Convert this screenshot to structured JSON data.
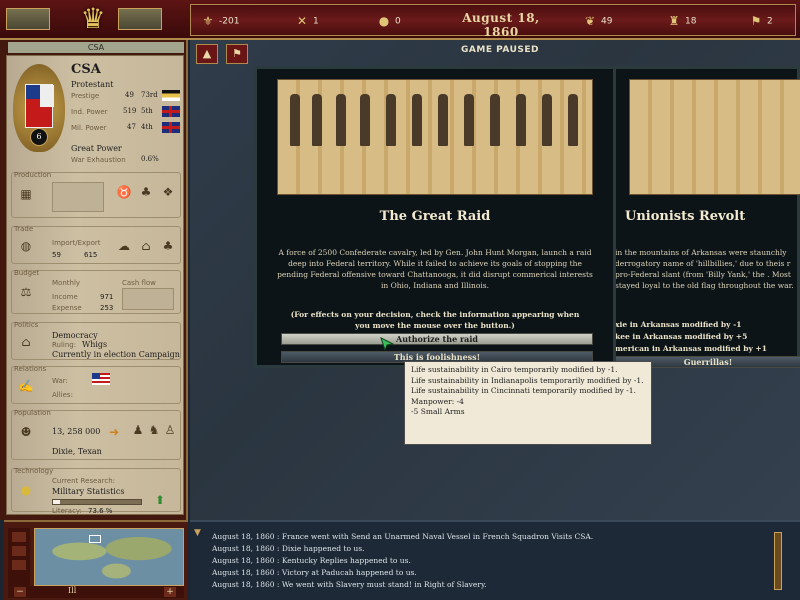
{
  "topbar": {
    "date": "August 18, 1860",
    "resources": [
      {
        "icon": "money-icon",
        "value": "-201"
      },
      {
        "icon": "crossed-swords-icon",
        "value": "1"
      },
      {
        "icon": "lightbulb-icon",
        "value": "0"
      },
      {
        "icon": "laurel-icon",
        "value": "49"
      },
      {
        "icon": "soldier-icon",
        "value": "18"
      },
      {
        "icon": "flag-icon",
        "value": "2"
      }
    ]
  },
  "nation": {
    "tab": "CSA",
    "name": "CSA",
    "religion": "Protestant",
    "prestige_label": "Prestige",
    "prestige_value": "49",
    "prestige_rank": "73rd",
    "ind_label": "Ind. Power",
    "ind_value": "519",
    "ind_rank": "5th",
    "mil_label": "Mil. Power",
    "mil_value": "47",
    "mil_rank": "4th",
    "rank_badge": "6",
    "status": "Great Power",
    "war_exh_label": "War Exhaustion",
    "war_exh_value": "0.6%"
  },
  "production": {
    "title": "Production"
  },
  "trade": {
    "title": "Trade",
    "label": "Import/Export",
    "import": "59",
    "export": "615"
  },
  "budget": {
    "title": "Budget",
    "monthly": "Monthly",
    "cashflow": "Cash flow",
    "income_label": "Income",
    "income": "971",
    "expense_label": "Expense",
    "expense": "253"
  },
  "politics": {
    "title": "Politics",
    "government": "Democracy",
    "ruling_label": "Ruling:",
    "ruling": "Whigs",
    "election": "Currently in election Campaign"
  },
  "relations": {
    "title": "Relations",
    "war_label": "War:",
    "allies_label": "Allies:"
  },
  "population": {
    "title": "Population",
    "count": "13, 258 000",
    "culture": "Dixie, Texan"
  },
  "technology": {
    "title": "Technology",
    "current_label": "Current Research:",
    "current": "Military Statistics",
    "literacy_label": "Literacy:",
    "literacy": "73.6 %",
    "progress": 0.08
  },
  "map": {
    "paused": "GAME PAUSED"
  },
  "event_main": {
    "title": "The Great Raid",
    "text": "A force of 2500 Confederate cavalry, led by Gen. John Hunt Morgan, launch a raid deep into Federal territory. While it failed to achieve its goals of stopping the pending Federal offensive toward Chattanooga, it did disrupt commerical interests in Ohio, Indiana and Illinois.",
    "note": "(For effects on your decision, check the information appearing when you move the mouse over the button.)",
    "option_a": "Authorize the raid",
    "option_b": "This is foolishness!"
  },
  "event_back": {
    "title": "Unionists Revolt",
    "text": "in the mountains of Arkansas were staunchly derrogatory name of 'hillbillies,' due to theis r pro-Federal slant (from 'Billy Yank,' the . Most stayed loyal to the old flag throughout the war.",
    "effect1": "xie in Arkansas modified by -1",
    "effect2": "kee in Arkansas modified by +5",
    "effect3": "merican in Arkansas modified by +1",
    "option": "Guerrillas!"
  },
  "tooltip": {
    "lines": [
      "Life sustainability in Cairo temporarily modified by -1.",
      "Life sustainability in Indianapolis temporarily modified by -1.",
      "Life sustainability in Cincinnati temporarily modified by -1.",
      "Manpower: -4",
      "-5 Small Arms"
    ]
  },
  "minimap": {
    "zoom": "Ill"
  },
  "log": [
    "August 18, 1860 : France went with Send an Unarmed Naval Vessel in French Squadron Visits CSA.",
    "August 18, 1860 : Dixie happened to us.",
    "August 18, 1860 : Kentucky Replies happened to us.",
    "August 18, 1860 : Victory at Paducah happened to us.",
    "August 18, 1860 : We went with Slavery must stand! in Right of Slavery."
  ],
  "colors": {
    "csa_red": "#c41a1a",
    "parchment": "#cdbfa2",
    "topbar": "#5d1414",
    "gold": "#c9a25d"
  }
}
